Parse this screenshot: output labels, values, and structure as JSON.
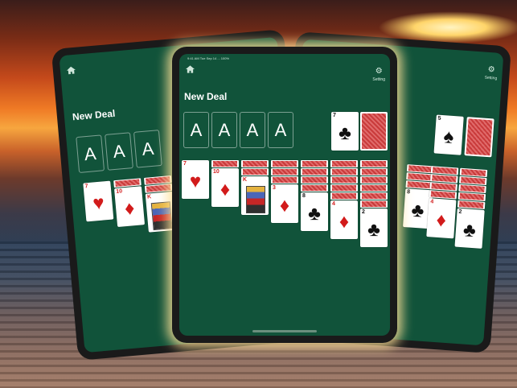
{
  "status_text": "9:41 AM  Tue Sep 14   ...   100%",
  "icons": {
    "home": "home-icon",
    "gear": "gear-icon"
  },
  "header": {
    "title": "New Deal",
    "setting_label": "Setting"
  },
  "foundations": [
    "A",
    "A",
    "A",
    "A"
  ],
  "stock": {
    "waste_rank": "7",
    "waste_suit": "♣"
  },
  "right_stock": {
    "waste_rank": "5",
    "waste_suit": "♠"
  },
  "tableau_front": [
    {
      "rank": "7",
      "suit": "♥",
      "color": "red"
    },
    {
      "rank": "10",
      "suit": "♦",
      "color": "red"
    },
    {
      "rank": "K",
      "suit": "♥",
      "color": "red"
    },
    {
      "rank": "3",
      "suit": "♦",
      "color": "red"
    },
    {
      "rank": "8",
      "suit": "♣",
      "color": "black"
    },
    {
      "rank": "4",
      "suit": "♦",
      "color": "red"
    },
    {
      "rank": "2",
      "suit": "♣",
      "color": "black"
    }
  ],
  "colors": {
    "felt": "#11533a",
    "card_back": "#c93b3b",
    "red_suit": "#d21b1b"
  }
}
